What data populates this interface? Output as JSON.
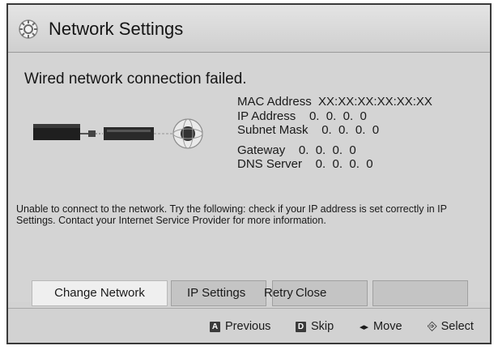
{
  "window": {
    "title": "Network Settings",
    "icon": "gear-icon"
  },
  "status": {
    "message": "Wired network connection failed."
  },
  "info": {
    "mac": "MAC Address  XX:XX:XX:XX:XX:XX",
    "ip": "IP Address    0.  0.  0.  0",
    "subnet": "Subnet Mask    0.  0.  0.  0",
    "gateway": "Gateway    0.  0.  0.  0",
    "dns": "DNS Server    0.  0.  0.  0"
  },
  "help_text": "Unable to connect to the network. Try the following: check if your IP address is set correctly in IP Settings. Contact your Internet Service Provider for more information.",
  "buttons": {
    "change_network": "Change Network",
    "ip_settings": "IP Settings",
    "retry": "Retry",
    "close": "Close"
  },
  "footer": {
    "previous_key": "A",
    "previous": "Previous",
    "skip_key": "D",
    "skip": "Skip",
    "move_glyph": "◂▸",
    "move": "Move",
    "select_glyph": "⎆",
    "select": "Select"
  }
}
